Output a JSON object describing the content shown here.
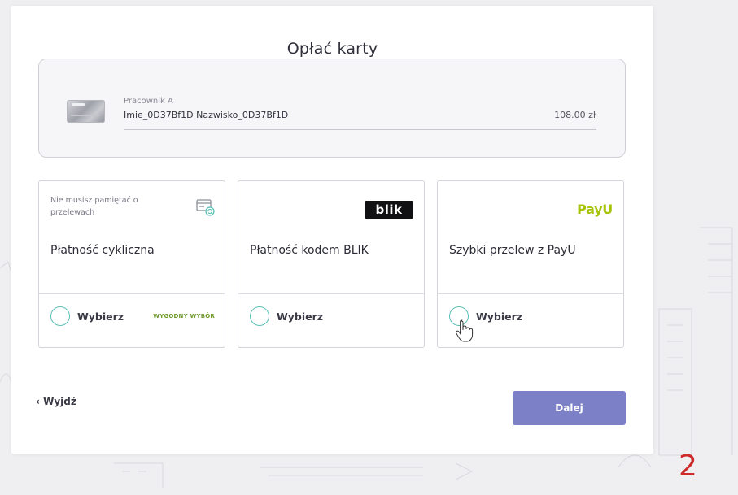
{
  "modal": {
    "title": "Opłać karty"
  },
  "employee": {
    "role": "Pracownik A",
    "name": "Imie_0D37Bf1D Nazwisko_0D37Bf1D",
    "amount": "108.00 zł"
  },
  "options": [
    {
      "hint": "Nie musisz pamiętać o przelewach",
      "title": "Płatność cykliczna",
      "select_label": "Wybierz",
      "tag": "WYGODNY WYBÓR",
      "icon": "recurring-payment-icon"
    },
    {
      "logo_text": "blik",
      "title": "Płatność kodem BLIK",
      "select_label": "Wybierz",
      "icon": "blik-logo"
    },
    {
      "logo_text": "PayU",
      "title": "Szybki przelew z PayU",
      "select_label": "Wybierz",
      "icon": "payu-logo"
    }
  ],
  "footer": {
    "exit_label": "Wyjdź",
    "next_label": "Dalej"
  },
  "step_number": "2",
  "colors": {
    "accent_teal": "#5bc0b6",
    "button_purple": "#7b80c7",
    "payu_green": "#a6c307",
    "tag_green": "#6d9a2a",
    "step_red": "#cf2a2a"
  }
}
